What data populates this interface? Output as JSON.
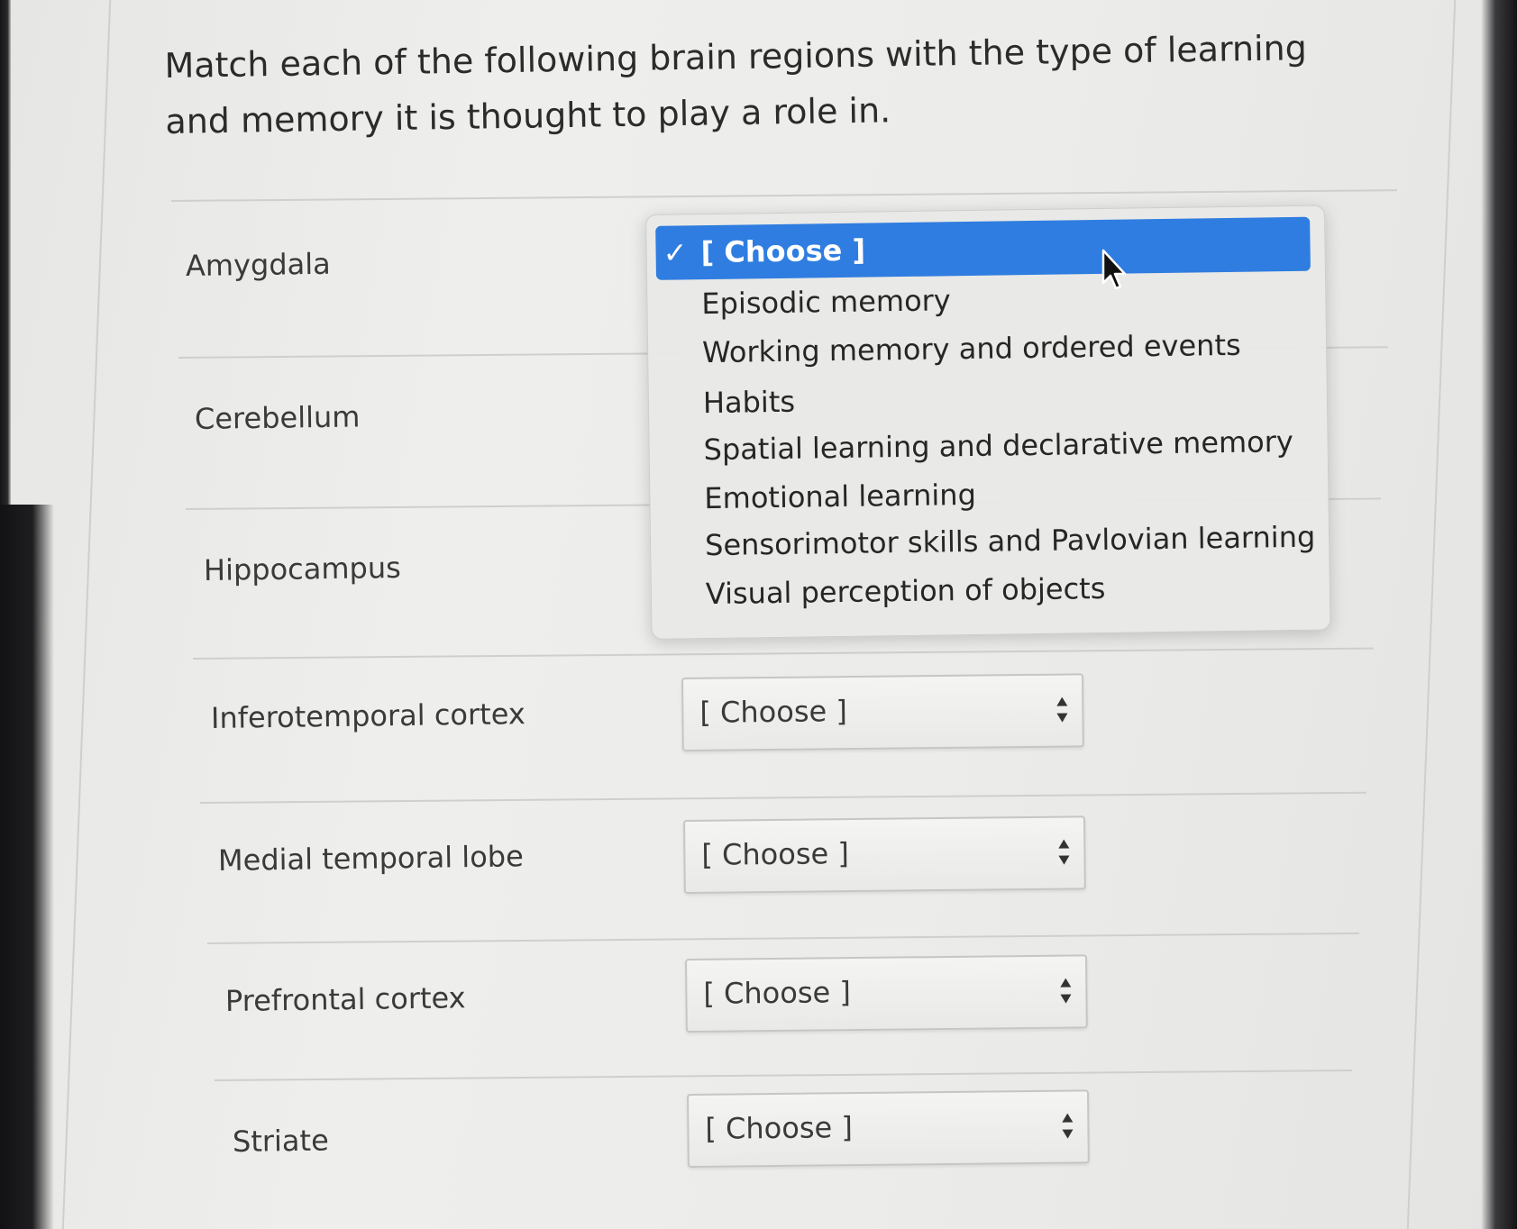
{
  "question": "Match each of the following brain regions with the type of learning and memory it is thought to play a role in.",
  "rows": [
    {
      "label": "Amygdala",
      "selected": "[ Choose ]"
    },
    {
      "label": "Cerebellum",
      "selected": "[ Choose ]"
    },
    {
      "label": "Hippocampus",
      "selected": "[ Choose ]"
    },
    {
      "label": "Inferotemporal cortex",
      "selected": "[ Choose ]"
    },
    {
      "label": "Medial temporal lobe",
      "selected": "[ Choose ]"
    },
    {
      "label": "Prefrontal cortex",
      "selected": "[ Choose ]"
    },
    {
      "label": "Striate",
      "selected": "[ Choose ]"
    }
  ],
  "dropdown": {
    "selected_option": "[ Choose ]",
    "options": [
      "[ Choose ]",
      "Episodic memory",
      "Working memory and ordered events",
      "Habits",
      "Spatial learning and declarative memory",
      "Emotional learning",
      "Sensorimotor skills and Pavlovian learning",
      "Visual perception of objects"
    ],
    "highlight_color": "#2f7de0"
  },
  "icons": {
    "check": "checkmark-icon",
    "select_arrows": "select-arrows-icon",
    "cursor": "mouse-pointer-icon"
  }
}
